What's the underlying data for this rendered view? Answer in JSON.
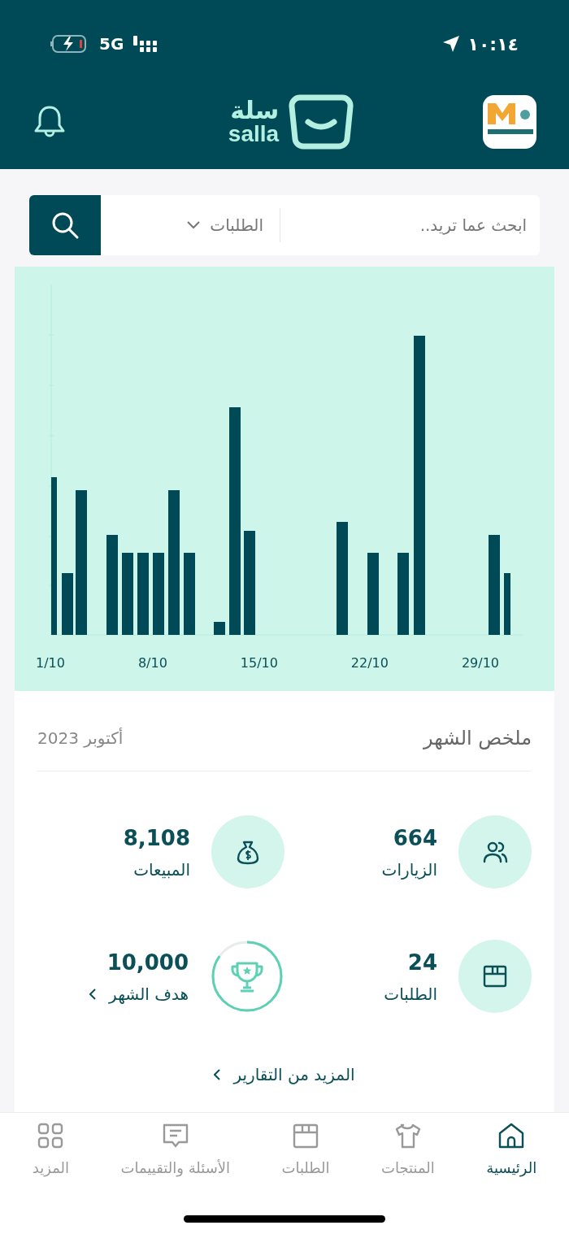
{
  "status_bar": {
    "time": "١٠:١٤",
    "network": "5G"
  },
  "header": {
    "logo_arabic": "سلة",
    "logo_latin": "salla"
  },
  "search": {
    "placeholder": "ابحث عما تريد..",
    "scope": "الطلبات"
  },
  "chart": {
    "x_labels": [
      "29/10",
      "22/10",
      "15/10",
      "8/10",
      "1/10"
    ]
  },
  "summary": {
    "title": "ملخص الشهر",
    "period": "أكتوبر 2023",
    "stats": [
      {
        "kind": "visits",
        "value": "664",
        "label": "الزيارات"
      },
      {
        "kind": "sales",
        "value": "8,108",
        "label": "المبيعات"
      },
      {
        "kind": "orders",
        "value": "24",
        "label": "الطلبات"
      },
      {
        "kind": "goal",
        "value": "10,000",
        "label": "هدف الشهر"
      }
    ],
    "more_link": "المزيد من التقارير"
  },
  "bottom_nav": [
    {
      "kind": "home",
      "label": "الرئيسية",
      "selected": true
    },
    {
      "kind": "products",
      "label": "المنتجات",
      "selected": false
    },
    {
      "kind": "orders",
      "label": "الطلبات",
      "selected": false
    },
    {
      "kind": "reviews",
      "label": "الأسئلة والتقييمات",
      "selected": false
    },
    {
      "kind": "more",
      "label": "المزيد",
      "selected": false
    }
  ]
}
